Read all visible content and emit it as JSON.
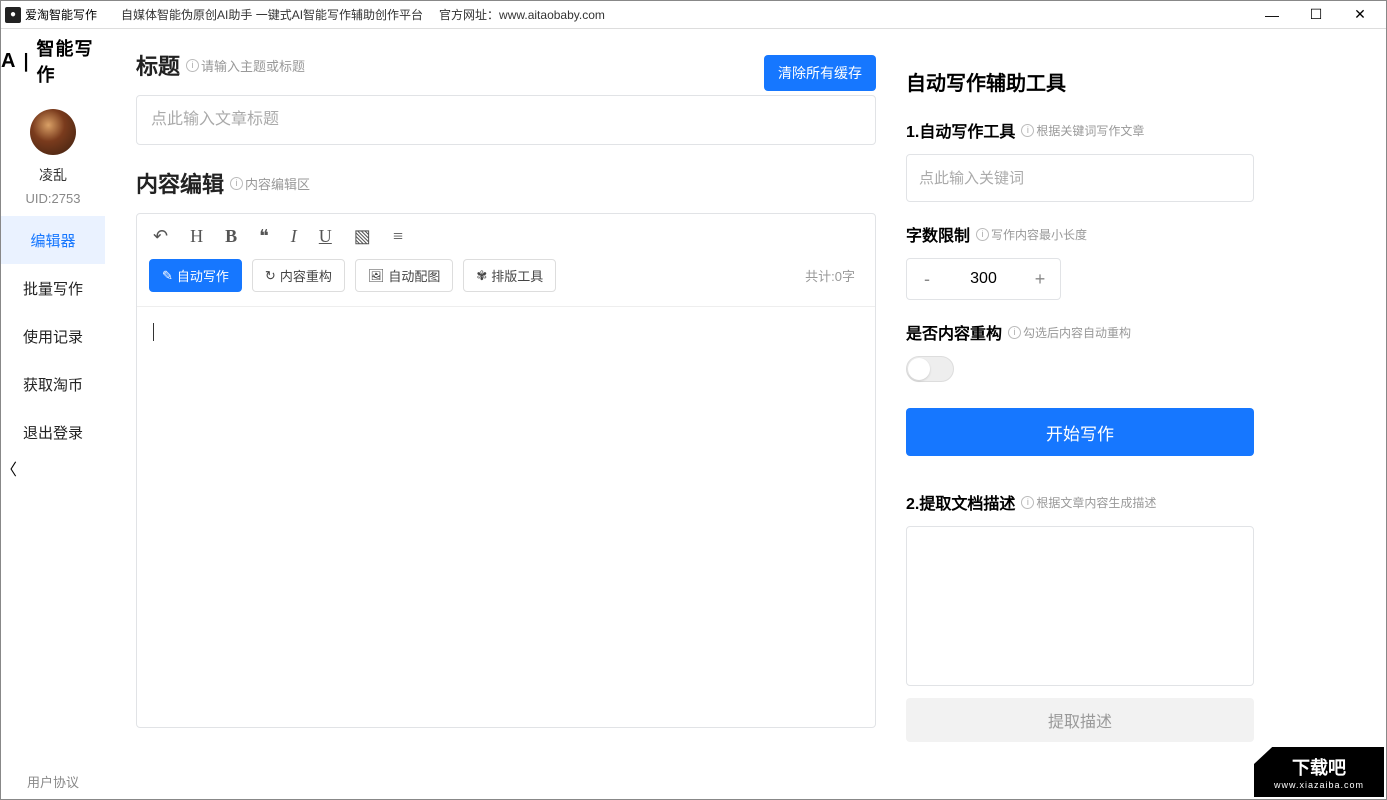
{
  "window": {
    "app_name": "爱淘智能写作",
    "subtitle": "自媒体智能伪原创AI助手   一键式AI智能写作辅助创作平台",
    "url_label": "官方网址：",
    "url": "www.aitaobaby.com"
  },
  "sidebar": {
    "logo_text": "智能写作",
    "username": "凌乱",
    "uid": "UID:2753",
    "items": [
      {
        "label": "编辑器",
        "active": true
      },
      {
        "label": "批量写作",
        "active": false
      },
      {
        "label": "使用记录",
        "active": false
      },
      {
        "label": "获取淘币",
        "active": false
      },
      {
        "label": "退出登录",
        "active": false
      }
    ],
    "footer": "用户协议"
  },
  "main": {
    "title_label": "标题",
    "title_hint": "请输入主题或标题",
    "clear_cache": "清除所有缓存",
    "title_placeholder": "点此输入文章标题",
    "content_label": "内容编辑",
    "content_hint": "内容编辑区",
    "toolbar": {
      "auto_write": "自动写作",
      "restructure": "内容重构",
      "auto_image": "自动配图",
      "layout_tool": "排版工具"
    },
    "counter": "共计:0字"
  },
  "side": {
    "panel_title": "自动写作辅助工具",
    "s1_title": "1.自动写作工具",
    "s1_hint": "根据关键词写作文章",
    "kw_placeholder": "点此输入关键词",
    "limit_title": "字数限制",
    "limit_hint": "写作内容最小长度",
    "limit_value": "300",
    "recon_title": "是否内容重构",
    "recon_hint": "勾选后内容自动重构",
    "start": "开始写作",
    "s2_title": "2.提取文档描述",
    "s2_hint": "根据文章内容生成描述",
    "extract": "提取描述"
  },
  "watermark": {
    "big": "下载吧",
    "small": "www.xiazaiba.com"
  }
}
